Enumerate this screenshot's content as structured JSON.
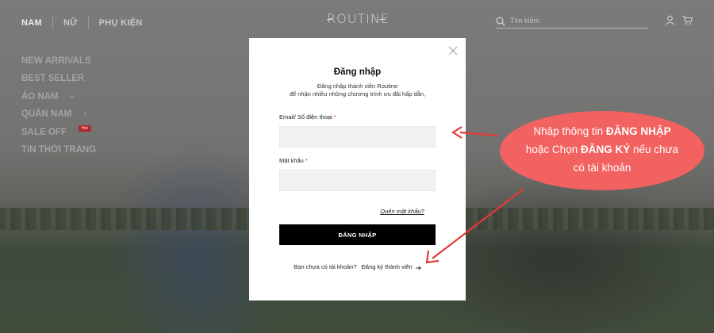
{
  "header": {
    "nav": [
      "NAM",
      "NỮ",
      "PHỤ KIỆN"
    ],
    "logo_text": "ROUTINE",
    "search_placeholder": "Tìm kiếm"
  },
  "side_menu": {
    "items": [
      {
        "label": "NEW ARRIVALS"
      },
      {
        "label": "BEST SELLER"
      },
      {
        "label": "ÁO NAM",
        "expand": "+"
      },
      {
        "label": "QUẦN NAM",
        "expand": "+"
      },
      {
        "label": "SALE OFF",
        "badge": "Hot"
      },
      {
        "label": "TIN THỜI TRANG"
      }
    ]
  },
  "modal": {
    "title": "Đăng nhập",
    "desc_line1": "Đăng nhập thành viên Routine",
    "desc_line2": "để nhận nhiều những chương trình ưu đãi hấp dẫn,",
    "email_label": "Email/ Số điện thoại",
    "password_label": "Mật khẩu",
    "required_mark": "*",
    "forgot_link": "Quên mật khẩu?",
    "login_button": "ĐĂNG NHẬP",
    "no_account_text": "Bạn chưa có tài khoản?",
    "register_link": "Đăng ký thành viên"
  },
  "annotation": {
    "line1_pre": "Nhập thông tin ",
    "line1_bold": "ĐĂNG NHẬP",
    "line2_pre": "hoặc Chọn ",
    "line2_bold": "ĐĂNG KÝ",
    "line2_post": " nếu chưa",
    "line3": "có tài khoản"
  },
  "colors": {
    "callout": "#f26260",
    "arrow": "#e53935",
    "badge": "#b3262a",
    "button": "#000000"
  },
  "icons": [
    "search-icon",
    "user-icon",
    "cart-icon",
    "close-icon",
    "arrow-right-icon"
  ]
}
